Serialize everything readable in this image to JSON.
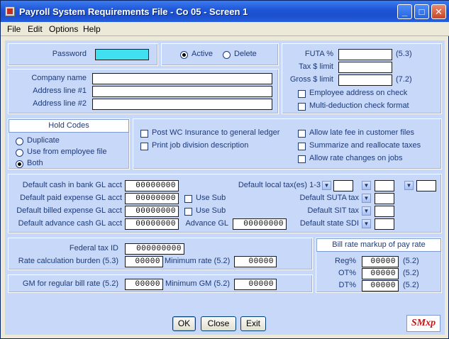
{
  "window": {
    "title": "Payroll System Requirements File - Co 05 - Screen 1",
    "controls": {
      "minimize": "_",
      "maximize": "□",
      "close": "✕"
    }
  },
  "menu": [
    "File",
    "Edit",
    "Options",
    "Help"
  ],
  "password": {
    "label": "Password",
    "value": ""
  },
  "status": {
    "options": [
      "Active",
      "Delete"
    ],
    "selected": "Active"
  },
  "company": {
    "name_label": "Company name",
    "address1_label": "Address line #1",
    "address2_label": "Address line #2",
    "name": "",
    "address1": "",
    "address2": ""
  },
  "futa": {
    "futa_label": "FUTA %",
    "futa_ref": "(5.3)",
    "tax_limit_label": "Tax $ limit",
    "gross_limit_label": "Gross $ limit",
    "gross_ref": "(7.2)",
    "futa_value": "",
    "tax_limit_value": "",
    "gross_limit_value": ""
  },
  "options_top": {
    "employee_address": "Employee address on check",
    "multi_deduction": "Multi-deduction check format"
  },
  "hold_codes": {
    "title": "Hold Codes",
    "options": [
      "Duplicate",
      "Use from employee file",
      "Both"
    ],
    "selected": "Both"
  },
  "checks": {
    "post_wc": "Post WC Insurance to general ledger",
    "print_job": "Print job division description",
    "allow_late_fee": "Allow late fee in customer files",
    "summarize": "Summarize and reallocate taxes",
    "allow_rate": "Allow rate changes on jobs"
  },
  "gl": {
    "cash_label": "Default cash in bank GL acct",
    "cash_value": "00000000",
    "paid_label": "Default paid expense GL acct",
    "paid_value": "00000000",
    "billed_label": "Default billed expense GL acct",
    "billed_value": "00000000",
    "advance_label": "Default advance cash GL acct",
    "advance_value": "00000000",
    "use_sub": "Use Sub",
    "advance_gl_label": "Advance GL",
    "advance_gl_value": "00000000"
  },
  "taxes": {
    "local_label": "Default local tax(es) 1-3",
    "suta_label": "Default SUTA tax",
    "sit_label": "Default SIT tax",
    "sdi_label": "Default state SDI",
    "dropdown_icon": "chevron-down-icon"
  },
  "federal": {
    "tax_id_label": "Federal tax ID",
    "tax_id_value": "000000000",
    "burden_label": "Rate calculation burden (5.3)",
    "burden_value": "00000",
    "min_rate_label": "Minimum rate (5.2)",
    "min_rate_value": "00000",
    "gm_label": "GM for regular bill rate (5.2)",
    "gm_value": "00000",
    "min_gm_label": "Minimum GM (5.2)",
    "min_gm_value": "00000"
  },
  "markup": {
    "title": "Bill rate markup of pay rate",
    "reg_label": "Reg%",
    "reg_value": "00000",
    "ot_label": "OT%",
    "ot_value": "00000",
    "dt_label": "DT%",
    "dt_value": "00000",
    "ref": "(5.2)"
  },
  "buttons": {
    "ok": "OK",
    "close": "Close",
    "exit": "Exit"
  },
  "logo_text": "SMxp",
  "colors": {
    "title_bar": "#1e54d6",
    "client_bg": "#c8d8f8",
    "label": "#1c3a7a",
    "password_field": "#40e0f0"
  }
}
